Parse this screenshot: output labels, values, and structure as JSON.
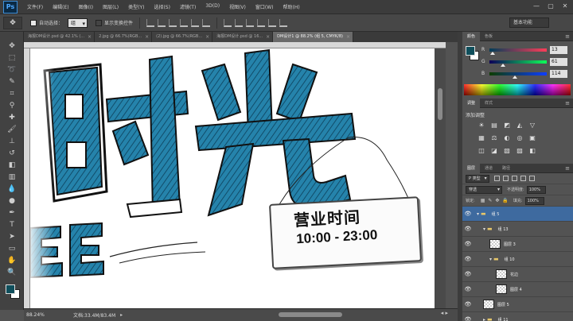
{
  "app": {
    "logo": "Ps",
    "menus": [
      "文件(F)",
      "编辑(E)",
      "图像(I)",
      "图层(L)",
      "类型(Y)",
      "选择(S)",
      "滤镜(T)",
      "3D(D)",
      "视图(V)",
      "窗口(W)",
      "帮助(H)"
    ],
    "window_controls": [
      "—",
      "▢",
      "✕"
    ]
  },
  "options": {
    "auto_select_label": "自动选择：",
    "auto_select_value": "组",
    "transform_label": "显示变换控件",
    "workspace": "基本功能"
  },
  "doc_tabs": [
    {
      "label": "海报DM设计.psd @ 42.1% (...",
      "active": false
    },
    {
      "label": "2.jpg @ 66.7%(RGB...",
      "active": false
    },
    {
      "label": "(2).jpg @ 66.7%(RGB...",
      "active": false
    },
    {
      "label": "海报DM设计.psd @ 16...",
      "active": false
    },
    {
      "label": "DM设计1 @ 88.2% (组 5, CMYK/8)",
      "active": true
    }
  ],
  "canvas": {
    "headline_chars": [
      "时",
      "光"
    ],
    "sign_title": "营业时间",
    "sign_hours": "10:00 - 23:00"
  },
  "status": {
    "zoom": "88.24%",
    "doc_size": "文档:33.4M/83.4M"
  },
  "color_panel": {
    "tabs": [
      "颜色",
      "色板"
    ],
    "sliders": [
      {
        "label": "R",
        "value": "13",
        "color_start": "#003d59",
        "color_end": "#ff3d59"
      },
      {
        "label": "G",
        "value": "61",
        "color_start": "#0d0059",
        "color_end": "#0dff59"
      },
      {
        "label": "B",
        "value": "114",
        "color_start": "#0d3d00",
        "color_end": "#0d3dff"
      }
    ]
  },
  "adjust_panel": {
    "tabs": [
      "调整",
      "样式"
    ],
    "title": "添加调整",
    "icons": [
      "☀",
      "▤",
      "◩",
      "◭",
      "▽",
      "▦",
      "⚖",
      "◐",
      "◎",
      "▣",
      "◫",
      "◪",
      "▧",
      "▨",
      "◧"
    ]
  },
  "layers_panel": {
    "tabs": [
      "图层",
      "通道",
      "路径"
    ],
    "filter_label": "P 类型",
    "blend_mode": "穿透",
    "opacity_label": "不透明度:",
    "opacity_value": "100%",
    "lock_label": "锁定:",
    "fill_label": "填充:",
    "fill_value": "100%",
    "layers": [
      {
        "name": "组 5",
        "type": "group",
        "indent": 0,
        "expanded": true,
        "selected": true
      },
      {
        "name": "组 13",
        "type": "group",
        "indent": 1,
        "expanded": true,
        "selected": false
      },
      {
        "name": "图层 3",
        "type": "layer",
        "indent": 2,
        "selected": false
      },
      {
        "name": "组 10",
        "type": "group",
        "indent": 2,
        "expanded": true,
        "selected": false
      },
      {
        "name": "花边",
        "type": "layer",
        "indent": 3,
        "selected": false
      },
      {
        "name": "图层 4",
        "type": "layer",
        "indent": 3,
        "selected": false
      },
      {
        "name": "图层 5",
        "type": "layer",
        "indent": 1,
        "selected": false
      },
      {
        "name": "组 11",
        "type": "group",
        "indent": 1,
        "expanded": false,
        "selected": false
      }
    ]
  },
  "colors": {
    "accent_blue": "#1f7fa8",
    "foreground": "#0f4f5c",
    "selection": "#3e6a9f"
  }
}
